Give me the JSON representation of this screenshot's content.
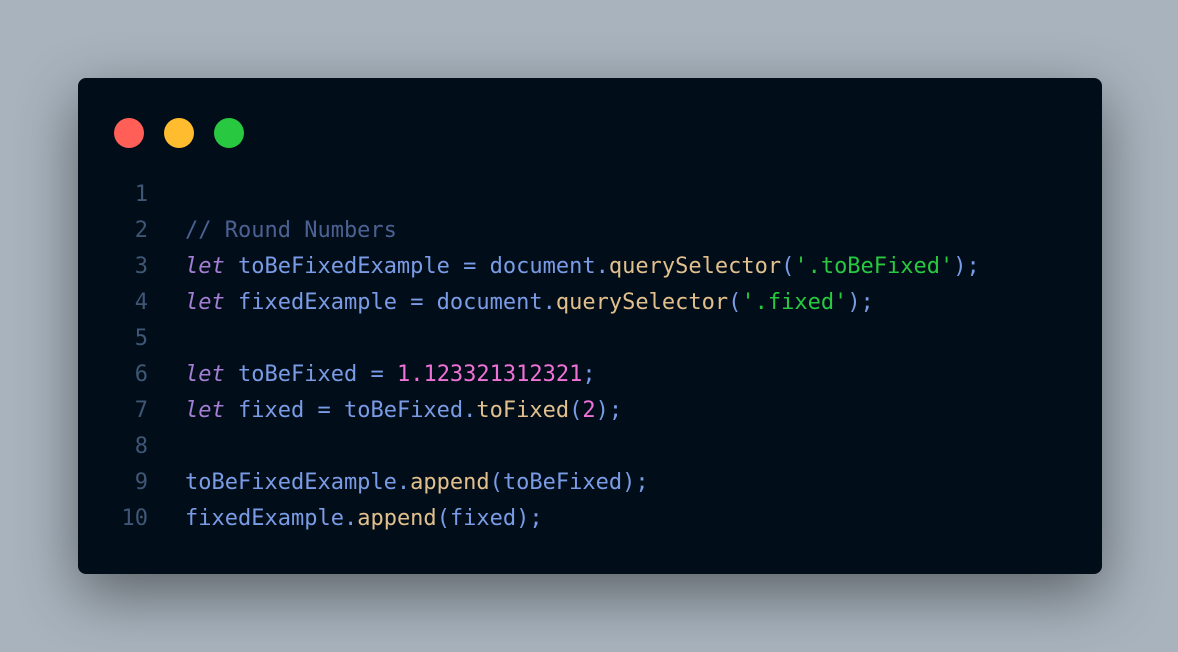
{
  "window": {
    "controls": [
      "close",
      "minimize",
      "maximize"
    ]
  },
  "code": {
    "lines": [
      {
        "n": "1",
        "tokens": []
      },
      {
        "n": "2",
        "tokens": [
          {
            "t": "// Round Numbers",
            "k": "comment"
          }
        ]
      },
      {
        "n": "3",
        "tokens": [
          {
            "t": "let",
            "k": "keyword"
          },
          {
            "t": " toBeFixedExample ",
            "k": "ident"
          },
          {
            "t": "=",
            "k": "punct"
          },
          {
            "t": " document",
            "k": "ident"
          },
          {
            "t": ".",
            "k": "punct"
          },
          {
            "t": "querySelector",
            "k": "func"
          },
          {
            "t": "(",
            "k": "punct"
          },
          {
            "t": "'.toBeFixed'",
            "k": "string"
          },
          {
            "t": ");",
            "k": "punct"
          }
        ]
      },
      {
        "n": "4",
        "tokens": [
          {
            "t": "let",
            "k": "keyword"
          },
          {
            "t": " fixedExample ",
            "k": "ident"
          },
          {
            "t": "=",
            "k": "punct"
          },
          {
            "t": " document",
            "k": "ident"
          },
          {
            "t": ".",
            "k": "punct"
          },
          {
            "t": "querySelector",
            "k": "func"
          },
          {
            "t": "(",
            "k": "punct"
          },
          {
            "t": "'.fixed'",
            "k": "string"
          },
          {
            "t": ");",
            "k": "punct"
          }
        ]
      },
      {
        "n": "5",
        "tokens": []
      },
      {
        "n": "6",
        "tokens": [
          {
            "t": "let",
            "k": "keyword"
          },
          {
            "t": " toBeFixed ",
            "k": "ident"
          },
          {
            "t": "=",
            "k": "punct"
          },
          {
            "t": " ",
            "k": "ident"
          },
          {
            "t": "1.123321312321",
            "k": "number"
          },
          {
            "t": ";",
            "k": "punct"
          }
        ]
      },
      {
        "n": "7",
        "tokens": [
          {
            "t": "let",
            "k": "keyword"
          },
          {
            "t": " fixed ",
            "k": "ident"
          },
          {
            "t": "=",
            "k": "punct"
          },
          {
            "t": " toBeFixed",
            "k": "ident"
          },
          {
            "t": ".",
            "k": "punct"
          },
          {
            "t": "toFixed",
            "k": "func"
          },
          {
            "t": "(",
            "k": "punct"
          },
          {
            "t": "2",
            "k": "number"
          },
          {
            "t": ");",
            "k": "punct"
          }
        ]
      },
      {
        "n": "8",
        "tokens": []
      },
      {
        "n": "9",
        "tokens": [
          {
            "t": "toBeFixedExample",
            "k": "ident"
          },
          {
            "t": ".",
            "k": "punct"
          },
          {
            "t": "append",
            "k": "func"
          },
          {
            "t": "(toBeFixed);",
            "k": "punct"
          }
        ]
      },
      {
        "n": "10",
        "tokens": [
          {
            "t": "fixedExample",
            "k": "ident"
          },
          {
            "t": ".",
            "k": "punct"
          },
          {
            "t": "append",
            "k": "func"
          },
          {
            "t": "(fixed);",
            "k": "punct"
          }
        ]
      }
    ]
  },
  "colors": {
    "background": "#a8b3bd",
    "window": "#010e19",
    "close": "#ff5f57",
    "minimize": "#febc2e",
    "maximize": "#28c840",
    "line_number": "#3f5675",
    "identifier": "#7a9be6",
    "keyword": "#a47ed3",
    "function": "#e2c08d",
    "string": "#28c840",
    "number": "#f072d6",
    "comment": "#4c6193"
  }
}
